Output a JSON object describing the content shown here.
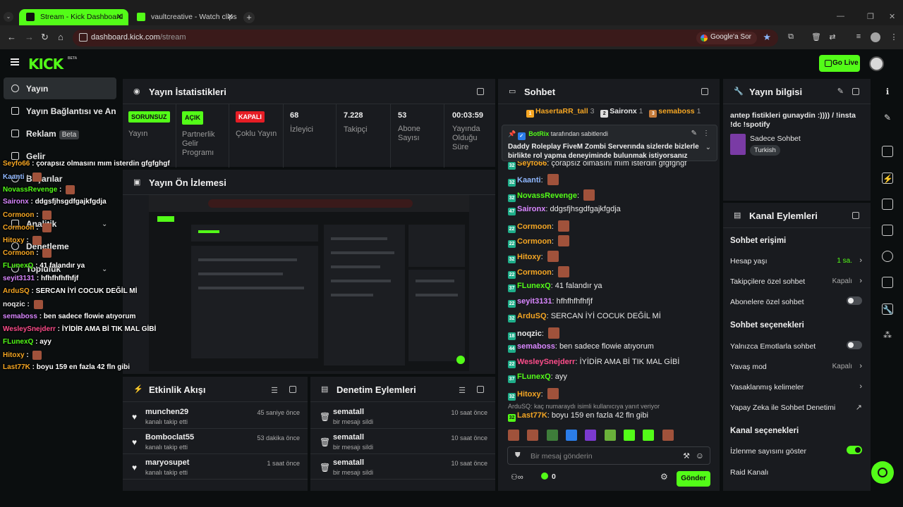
{
  "browser": {
    "tabs": [
      {
        "title": "Stream - Kick Dashboard",
        "active": true
      },
      {
        "title": "vaultcreative - Watch clips on K",
        "active": false
      }
    ],
    "url_host": "dashboard.kick.com",
    "url_path": "/stream",
    "google_button": "Google'a Sor"
  },
  "header": {
    "logo": "KICK",
    "logo_badge": "BETA",
    "golive_label": "Go Live"
  },
  "sidebar": {
    "items": [
      {
        "label": "Yayın",
        "active": true
      },
      {
        "label": "Yayın Bağlantısı ve Anahtar"
      },
      {
        "label": "Reklam",
        "badge": "Beta"
      },
      {
        "label": "Gelir"
      },
      {
        "label": "Başarılar"
      },
      {
        "label": "Analitik"
      },
      {
        "label": "Denetleme"
      },
      {
        "label": "Topluluk"
      }
    ]
  },
  "stats_panel": {
    "title": "Yayın İstatistikleri",
    "stats": [
      {
        "chip": "SORUNSUZ",
        "chip_color": "green",
        "label": "Yayın"
      },
      {
        "chip": "AÇIK",
        "chip_color": "green",
        "label": "Partnerlik Gelir Programı"
      },
      {
        "chip": "KAPALI",
        "chip_color": "red",
        "label": "Çoklu Yayın"
      },
      {
        "value": "68",
        "label": "İzleyici"
      },
      {
        "value": "7.228",
        "label": "Takipçi"
      },
      {
        "value": "53",
        "label": "Abone Sayısı"
      },
      {
        "value": "00:03:59",
        "label": "Yayında Olduğu Süre"
      }
    ]
  },
  "preview_panel": {
    "title": "Yayın Ön İzlemesi"
  },
  "activity_panel": {
    "title": "Etkinlik Akışı",
    "items": [
      {
        "name": "munchen29",
        "sub": "kanalı takip etti",
        "time": "45 saniye önce"
      },
      {
        "name": "Bomboclat55",
        "sub": "kanalı takip etti",
        "time": "53 dakika önce"
      },
      {
        "name": "maryosupet",
        "sub": "kanalı takip etti",
        "time": "1 saat önce"
      }
    ]
  },
  "moderation_panel": {
    "title": "Denetim Eylemleri",
    "items": [
      {
        "name": "sematall",
        "sub": "bir mesajı sildi",
        "time": "10 saat önce"
      },
      {
        "name": "sematall",
        "sub": "bir mesajı sildi",
        "time": "10 saat önce"
      },
      {
        "name": "sematall",
        "sub": "bir mesajı sildi",
        "time": "10 saat önce"
      }
    ]
  },
  "chat": {
    "title": "Sohbet",
    "top_gifters": [
      {
        "name": "HasertaRR_tall",
        "count": "3",
        "color": "#f5a623"
      },
      {
        "name": "Saironx",
        "count": "1",
        "color": "#e8e8e8"
      },
      {
        "name": "semaboss",
        "count": "1",
        "color": "#f5a623"
      }
    ],
    "pinned_by": "BotRix",
    "pinned_by_suffix": "tarafından sabitlendi",
    "pinned_text": "Daddy Roleplay FiveM Zombi Serverında sizlerde bizlerle birlikte rol yapma deneyiminde bulunmak istiyorsanız firsa...",
    "messages": [
      {
        "user": "Seyfo66",
        "color": "#f5a623",
        "text": "çorapsız olmasını mım isterdin gfgfghgf",
        "badge": "32"
      },
      {
        "user": "Kaanti",
        "color": "#8fb8ff",
        "text": "",
        "emote": true,
        "badge": "32"
      },
      {
        "user": "NovassRevenge",
        "color": "#53fc18",
        "text": "",
        "emote": true,
        "badge": "32"
      },
      {
        "user": "Saironx",
        "color": "#d987ff",
        "text": "ddgsfjhsgdfgajkfgdja",
        "badge": "47"
      },
      {
        "user": "Cormoon",
        "color": "#f5a623",
        "text": "",
        "emote": true,
        "badge": "22"
      },
      {
        "user": "Cormoon",
        "color": "#f5a623",
        "text": "",
        "emote": true,
        "badge": "22"
      },
      {
        "user": "Hitoxy",
        "color": "#f5a623",
        "text": "",
        "emote": true,
        "badge": "32"
      },
      {
        "user": "Cormoon",
        "color": "#f5a623",
        "text": "",
        "emote": true,
        "badge": "22"
      },
      {
        "user": "FLunexQ",
        "color": "#53fc18",
        "text": "41 falandır ya",
        "badge": "37"
      },
      {
        "user": "seyit3131",
        "color": "#d987ff",
        "text": "hfhfhfhfhfjf",
        "badge": "22"
      },
      {
        "user": "ArduSQ",
        "color": "#f5a623",
        "text": "SERCAN İYİ COCUK DEĞİL Mİ",
        "badge": "32"
      },
      {
        "user": "noqzic",
        "color": "#e8e8e8",
        "text": "",
        "emote": true,
        "badge": "18"
      },
      {
        "user": "semaboss",
        "color": "#d987ff",
        "text": "ben sadece flowie atıyorum",
        "badge": "44"
      },
      {
        "user": "WesleySnejderr",
        "color": "#ff4d8b",
        "text": "İYİDİR AMA Bİ TIK MAL GİBİ",
        "badge": "22"
      },
      {
        "user": "FLunexQ",
        "color": "#53fc18",
        "text": "ayy",
        "badge": "37"
      },
      {
        "user": "Hitoxy",
        "color": "#f5a623",
        "text": "",
        "emote": true,
        "badge": "32"
      }
    ],
    "reply_hint": "ArduSQ: kaç numaraydı isimli kullanıcıya yanıt veriyor",
    "last_message": {
      "user": "Last77K",
      "color": "#f5a623",
      "text": "boyu 159 en fazla 42 fln gibi",
      "badge": "32"
    },
    "input_placeholder": "Bir mesaj gönderin",
    "points": "0",
    "send_label": "Gönder"
  },
  "info_panel": {
    "title": "Yayın bilgisi",
    "stream_title": "antep fistikleri gunaydin :)))) / !insta !dc !spotify",
    "category": "Sadece Sohbet",
    "tag": "Turkish"
  },
  "channel_actions": {
    "title": "Kanal Eylemleri",
    "chat_access": "Sohbet erişimi",
    "account_age": {
      "label": "Hesap yaşı",
      "value": "1 sa."
    },
    "followers_only": {
      "label": "Takipçilere özel sohbet",
      "value": "Kapalı"
    },
    "subs_only": {
      "label": "Abonelere özel sohbet",
      "on": false
    },
    "chat_options": "Sohbet seçenekleri",
    "emotes_only": {
      "label": "Yalnızca Emotlarla sohbet",
      "on": false
    },
    "slow_mode": {
      "label": "Yavaş mod",
      "value": "Kapalı"
    },
    "banned_words": {
      "label": "Yasaklanmış kelimeler"
    },
    "ai_moderation": {
      "label": "Yapay Zeka ile Sohbet Denetimi"
    },
    "channel_options": "Kanal seçenekleri",
    "show_viewers": {
      "label": "İzlenme sayısını göster",
      "on": true
    },
    "raid": {
      "label": "Raid Kanalı"
    }
  },
  "overlay_chat": [
    {
      "user": "Seyfo66",
      "color": "#f5a623",
      "text": "çorapsız olmasını mım isterdin gfgfghgf"
    },
    {
      "user": "Kaanti",
      "color": "#8fb8ff",
      "text": ""
    },
    {
      "user": "NovassRevenge",
      "color": "#53fc18",
      "text": ""
    },
    {
      "user": "Saironx",
      "color": "#d987ff",
      "text": "ddgsfjhsgdfgajkfgdja"
    },
    {
      "user": "Cormoon",
      "color": "#f5a623",
      "text": ""
    },
    {
      "user": "Cormoon",
      "color": "#f5a623",
      "text": ""
    },
    {
      "user": "Hitoxy",
      "color": "#f5a623",
      "text": ""
    },
    {
      "user": "Cormoon",
      "color": "#f5a623",
      "text": ""
    },
    {
      "user": "FLunexQ",
      "color": "#53fc18",
      "text": "41 falandır ya"
    },
    {
      "user": "seyit3131",
      "color": "#d987ff",
      "text": "hfhfhfhfhfjf"
    },
    {
      "user": "ArduSQ",
      "color": "#f5a623",
      "text": "SERCAN İYİ COCUK DEĞİL Mİ"
    },
    {
      "user": "noqzic",
      "color": "#e8e8e8",
      "text": ""
    },
    {
      "user": "semaboss",
      "color": "#d987ff",
      "text": "ben sadece flowie atıyorum"
    },
    {
      "user": "WesleySnejderr",
      "color": "#ff4d8b",
      "text": "İYİDİR AMA Bİ TIK MAL GİBİ"
    },
    {
      "user": "FLunexQ",
      "color": "#53fc18",
      "text": "ayy"
    },
    {
      "user": "Hitoxy",
      "color": "#f5a623",
      "text": ""
    },
    {
      "user": "Last77K",
      "color": "#f5a623",
      "text": "boyu 159 en fazla 42 fln gibi"
    }
  ],
  "colors": {
    "accent": "#53fc18",
    "danger": "#e61d25",
    "panel": "#191b1f"
  }
}
